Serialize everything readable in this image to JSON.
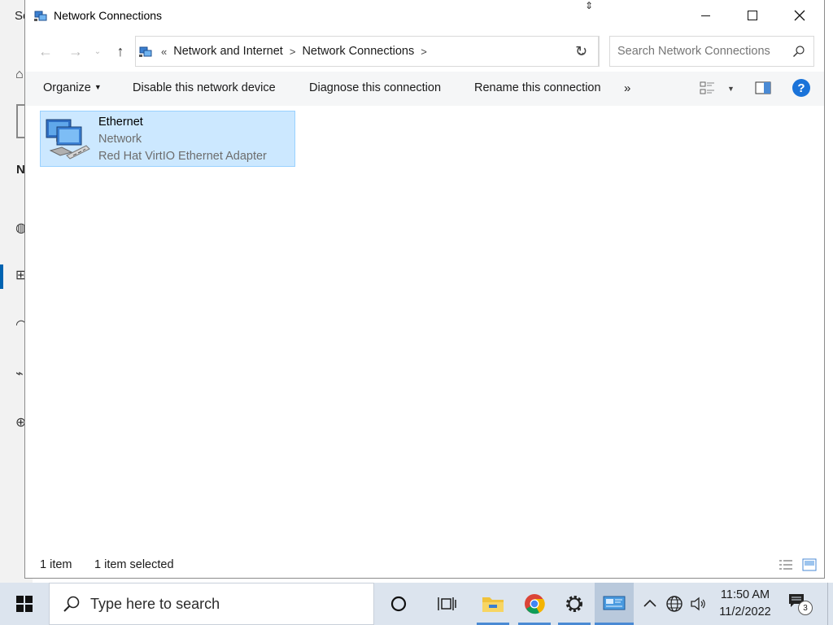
{
  "background_window": {
    "title_fragment": "Se",
    "heading_fragment": "N"
  },
  "window": {
    "title": "Network Connections",
    "caption_buttons": {
      "minimize": "minimize",
      "maximize": "maximize",
      "close": "close"
    }
  },
  "address": {
    "overflow": "«",
    "breadcrumbs": [
      "Network and Internet",
      "Network Connections"
    ],
    "separator": ">"
  },
  "search": {
    "placeholder": "Search Network Connections"
  },
  "commands": {
    "organize": "Organize",
    "disable": "Disable this network device",
    "diagnose": "Diagnose this connection",
    "rename": "Rename this connection",
    "more": "»",
    "help": "?"
  },
  "items": [
    {
      "name": "Ethernet",
      "status": "Network",
      "device": "Red Hat VirtIO Ethernet Adapter",
      "selected": true,
      "icon": "network-adapter-icon"
    }
  ],
  "status": {
    "count": "1 item",
    "selected": "1 item selected"
  },
  "taskbar": {
    "search_placeholder": "Type here to search",
    "time": "11:50 AM",
    "date": "11/2/2022",
    "notification_count": "3",
    "apps": [
      "cortana-icon",
      "task-view-icon",
      "file-explorer-icon",
      "chrome-icon",
      "settings-icon",
      "network-connections-icon"
    ]
  },
  "colors": {
    "selection_fill": "#cce8ff",
    "selection_border": "#99d1ff",
    "command_bar": "#f5f6f7",
    "taskbar": "#dce4ee",
    "accent": "#0063b1",
    "help_blue": "#1a73d9"
  }
}
